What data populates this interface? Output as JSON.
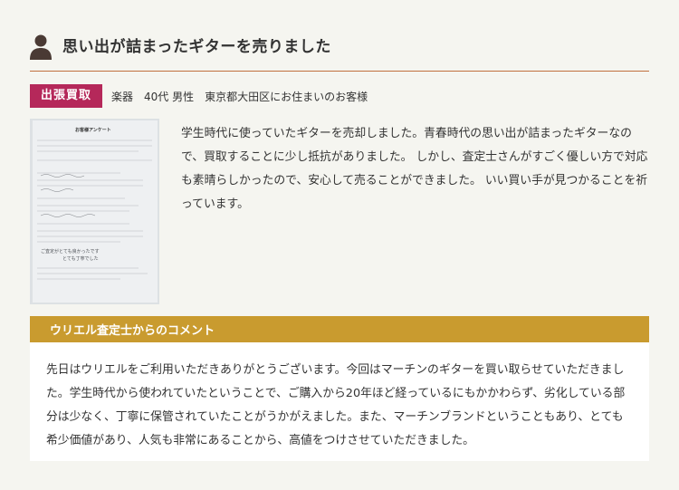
{
  "heading": {
    "title": "思い出が詰まったギターを売りました",
    "icon": "person-icon"
  },
  "customer": {
    "badge": "出張買取",
    "details": "楽器　40代 男性　東京都大田区にお住まいのお客様"
  },
  "survey_image": {
    "title": "お客様アンケート",
    "handwriting_1": "ご査定がとても良かったです",
    "handwriting_2": "とても丁寧でした"
  },
  "review": {
    "text": "学生時代に使っていたギターを売却しました。青春時代の思い出が詰まったギターなので、買取することに少し抵抗がありました。 しかし、査定士さんがすごく優しい方で対応も素晴らしかったので、安心して売ることができました。 いい買い手が見つかることを祈っています。"
  },
  "comment": {
    "heading": "ウリエル査定士からのコメント",
    "text": "先日はウリエルをご利用いただきありがとうございます。今回はマーチンのギターを買い取らせていただきました。学生時代から使われていたということで、ご購入から20年ほど経っているにもかかわらず、劣化している部分は少なく、丁寧に保管されていたことがうかがえました。また、マーチンブランドということもあり、とても希少価値があり、人気も非常にあることから、高値をつけさせていただきました。"
  },
  "colors": {
    "heading_rule": "#c0703e",
    "badge_bg": "#b5285a",
    "comment_header_bg": "#c99b2f",
    "page_bg": "#f5f5f0"
  }
}
